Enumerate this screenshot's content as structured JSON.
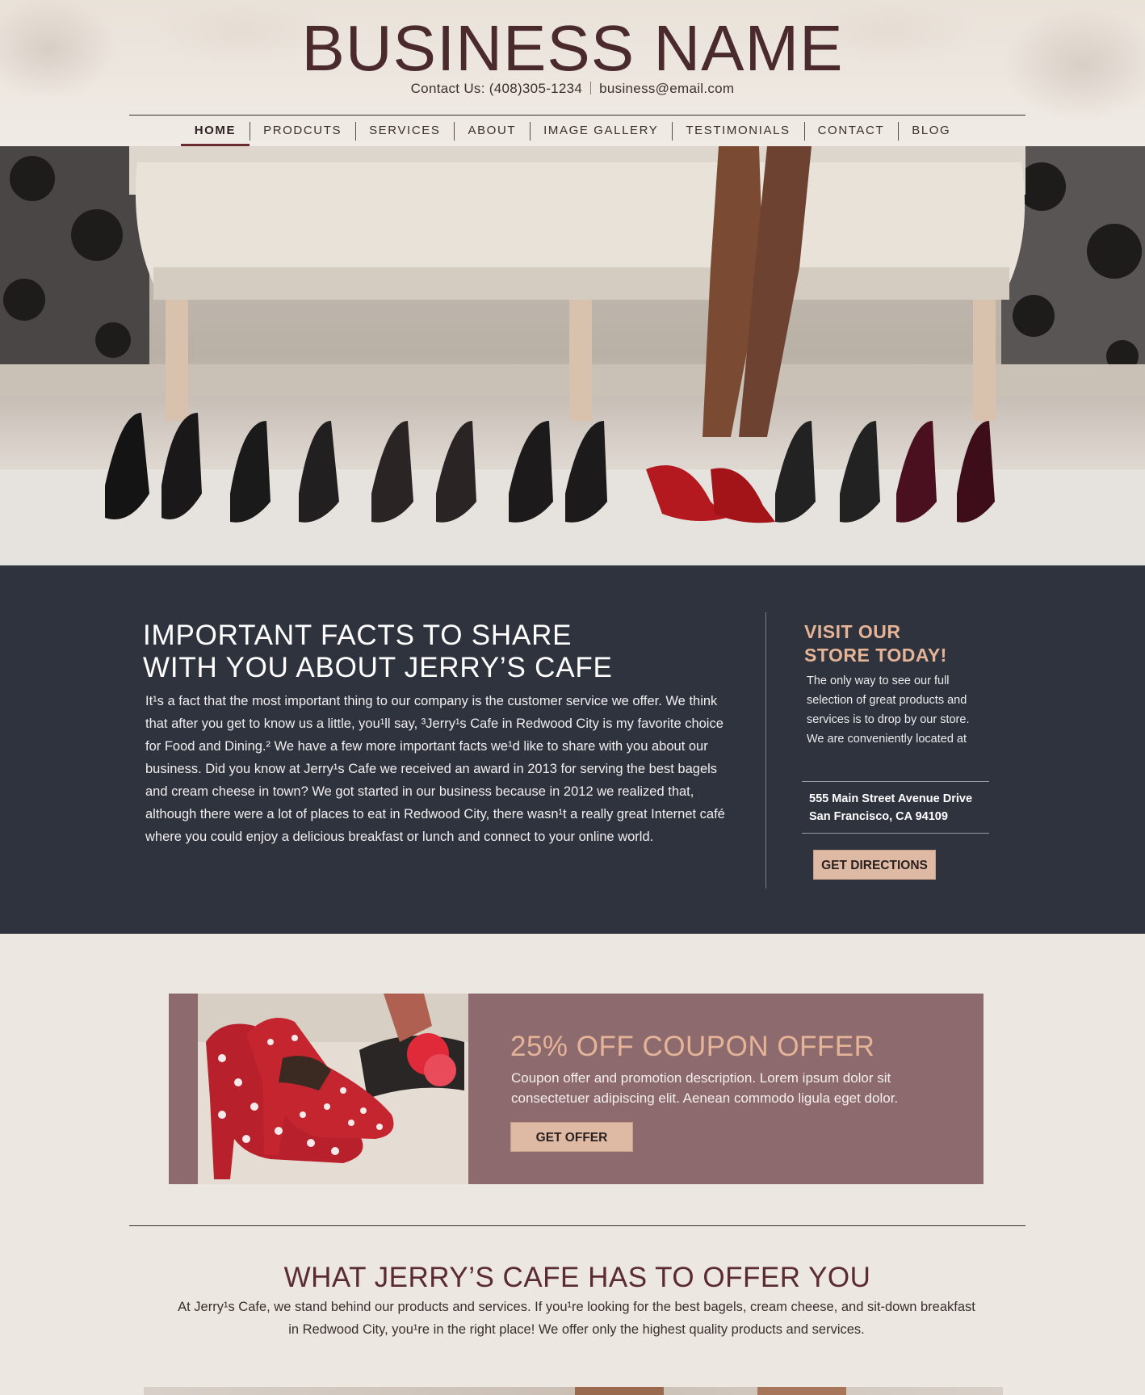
{
  "header": {
    "brand": "BUSINESS NAME",
    "contact_label": "Contact Us: (408)305-1234",
    "email": "business@email.com"
  },
  "nav": {
    "items": [
      "HOME",
      "PRODCUTS",
      "SERVICES",
      "ABOUT",
      "IMAGE GALLERY",
      "TESTIMONIALS",
      "CONTACT",
      "BLOG"
    ],
    "active": "HOME"
  },
  "facts": {
    "title_line1": "IMPORTANT FACTS TO SHARE",
    "title_line2": "WITH YOU ABOUT JERRY’S CAFE",
    "body": "It¹s a fact that the most important thing to our company is the customer service we offer. We think that after you get to know us a little, you¹ll say, ³Jerry¹s Cafe in Redwood City is my favorite choice for Food and Dining.² We have a few more important facts we¹d like to share with you about our business. Did you know at Jerry¹s Cafe we received an award in 2013 for serving the best bagels and cream cheese in town? We got started in our business because in 2012 we realized that, although there were a lot of places to eat in Redwood City, there wasn¹t a really great Internet café where you could enjoy a delicious breakfast or lunch and connect to your online world."
  },
  "visit": {
    "title_line1": "VISIT OUR",
    "title_line2": "STORE TODAY!",
    "text": "The only way to see our full selection  of great  products and services is to drop by our store.  We are conveniently located at",
    "address_line1": "555 Main Street Avenue Drive",
    "address_line2": "San  Francisco, CA 94109",
    "button": "GET DIRECTIONS"
  },
  "coupon": {
    "title": "25% OFF COUPON OFFER",
    "description": "Coupon offer and promotion description. Lorem ipsum dolor sit consectetuer adipiscing elit. Aenean commodo ligula eget dolor.",
    "button": "GET OFFER"
  },
  "offer": {
    "title": "WHAT JERRY’S CAFE HAS TO OFFER YOU",
    "body": "At Jerry¹s Cafe, we stand behind our products and services. If you¹re looking for the best bagels,  cream cheese, and sit-down breakfast in  Redwood City, you¹re in the right place! We offer only the highest quality products and  services."
  },
  "colors": {
    "brand": "#4a2a2c",
    "accent": "#e5b497",
    "button": "#deb9a3",
    "dark_section": "#2f333e",
    "coupon_bg": "#8c6a6e"
  }
}
